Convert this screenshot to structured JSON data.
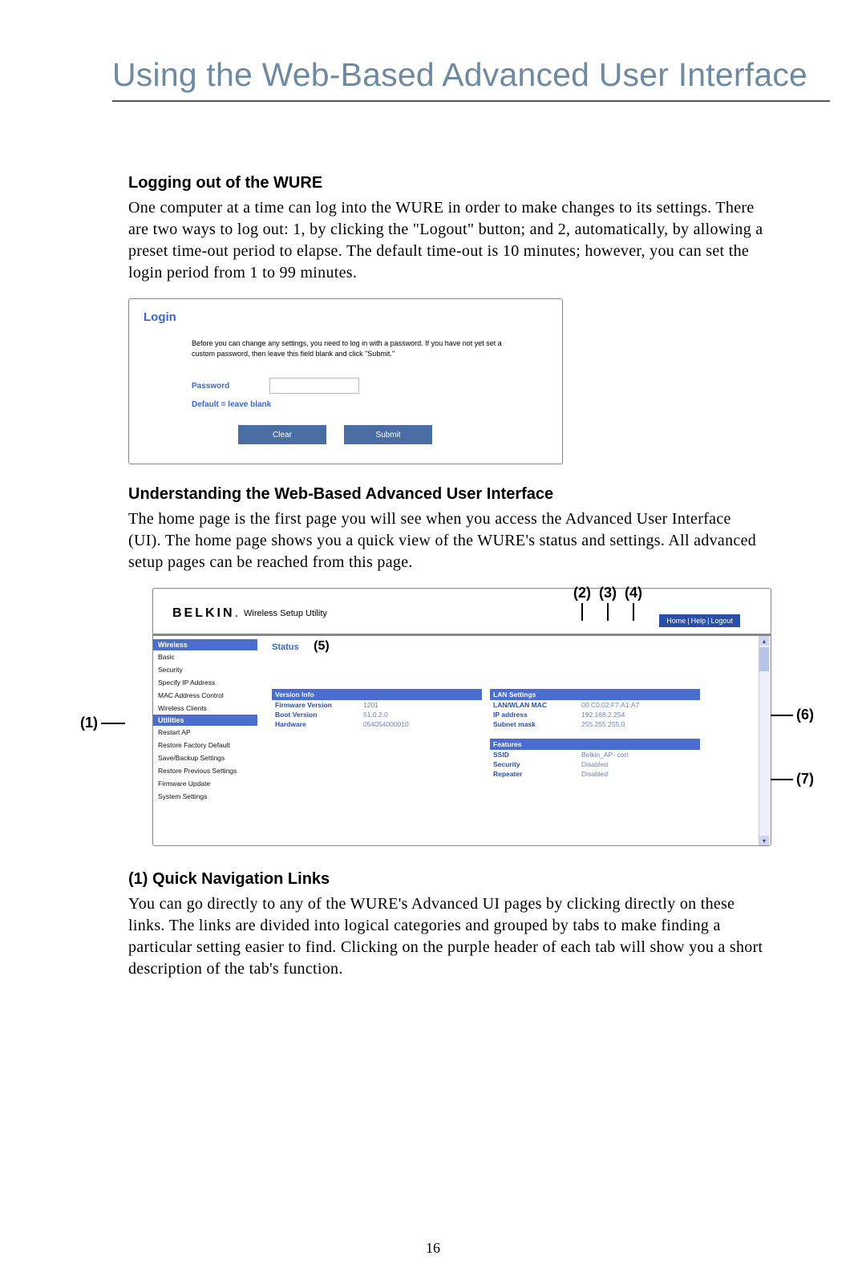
{
  "title": "Using the Web-Based Advanced User Interface",
  "sec1_heading": "Logging out of the WURE",
  "sec1_body": "One computer at a time can log into the WURE in order to make changes to its settings. There are two ways to log out: 1, by clicking the \"Logout\" button; and 2, automatically, by allowing a preset time-out period to elapse. The default time-out is 10 minutes; however, you can set the login period from 1 to 99 minutes.",
  "login": {
    "heading": "Login",
    "text": "Before you can change any settings, you need to log in with a password. If you have not yet set a custom password, then leave this field blank and click \"Submit.\"",
    "pw_label": "Password",
    "default": "Default = leave blank",
    "clear": "Clear",
    "submit": "Submit"
  },
  "sec2_heading": "Understanding the Web-Based Advanced User Interface",
  "sec2_body": "The home page is the first page you will see when you access the Advanced User Interface (UI). The home page shows you a quick view of the WURE's status and settings. All advanced setup pages can be reached from this page.",
  "annots": {
    "a1": "(1)",
    "a2": "(2)",
    "a3": "(3)",
    "a4": "(4)",
    "a5": "(5)",
    "a6": "(6)",
    "a7": "(7)"
  },
  "ui": {
    "brand_bold": "BELKIN",
    "brand_sub": "Wireless Setup Utility",
    "nav": {
      "home": "Home",
      "help": "Help",
      "logout": "Logout",
      "sep": "|"
    },
    "status_label": "Status",
    "side": {
      "wireless": "Wireless",
      "basic": "Basic",
      "security": "Security",
      "specify_ip": "Specify IP Address",
      "mac_ctrl": "MAC Address Control",
      "wclients": "Wireless Clients",
      "utilities": "Utilities",
      "restart": "Restart AP",
      "restore_def": "Restore Factory Default",
      "save_backup": "Save/Backup Settings",
      "restore_prev": "Restore Previous Settings",
      "fw_update": "Firmware Update",
      "sys_settings": "System Settings"
    },
    "version_info": {
      "heading": "Version Info",
      "fw_k": "Firmware Version",
      "fw_v": "1201",
      "boot_k": "Boot Version",
      "boot_v": "51.0.2.0",
      "hw_k": "Hardware",
      "hw_v": "054054000010"
    },
    "lan": {
      "heading": "LAN Settings",
      "mac_k": "LAN/WLAN MAC",
      "mac_v": "00:C0:02:F7:A1:A7",
      "ip_k": "IP address",
      "ip_v": "192.168.2.254",
      "sn_k": "Subnet mask",
      "sn_v": "255.255.255.0"
    },
    "features": {
      "heading": "Features",
      "ssid_k": "SSID",
      "ssid_v": "Belkin_AP- cort",
      "sec_k": "Security",
      "sec_v": "Disabled",
      "rep_k": "Repeater",
      "rep_v": "Disabled"
    }
  },
  "sec3_heading": "(1) Quick Navigation Links",
  "sec3_body": "You can go directly to any of the WURE's Advanced UI pages by clicking directly on these links. The links are divided into logical categories and grouped by tabs to make finding a particular setting easier to find. Clicking on the purple header of each tab will show you a short description of the tab's function.",
  "page_number": "16"
}
